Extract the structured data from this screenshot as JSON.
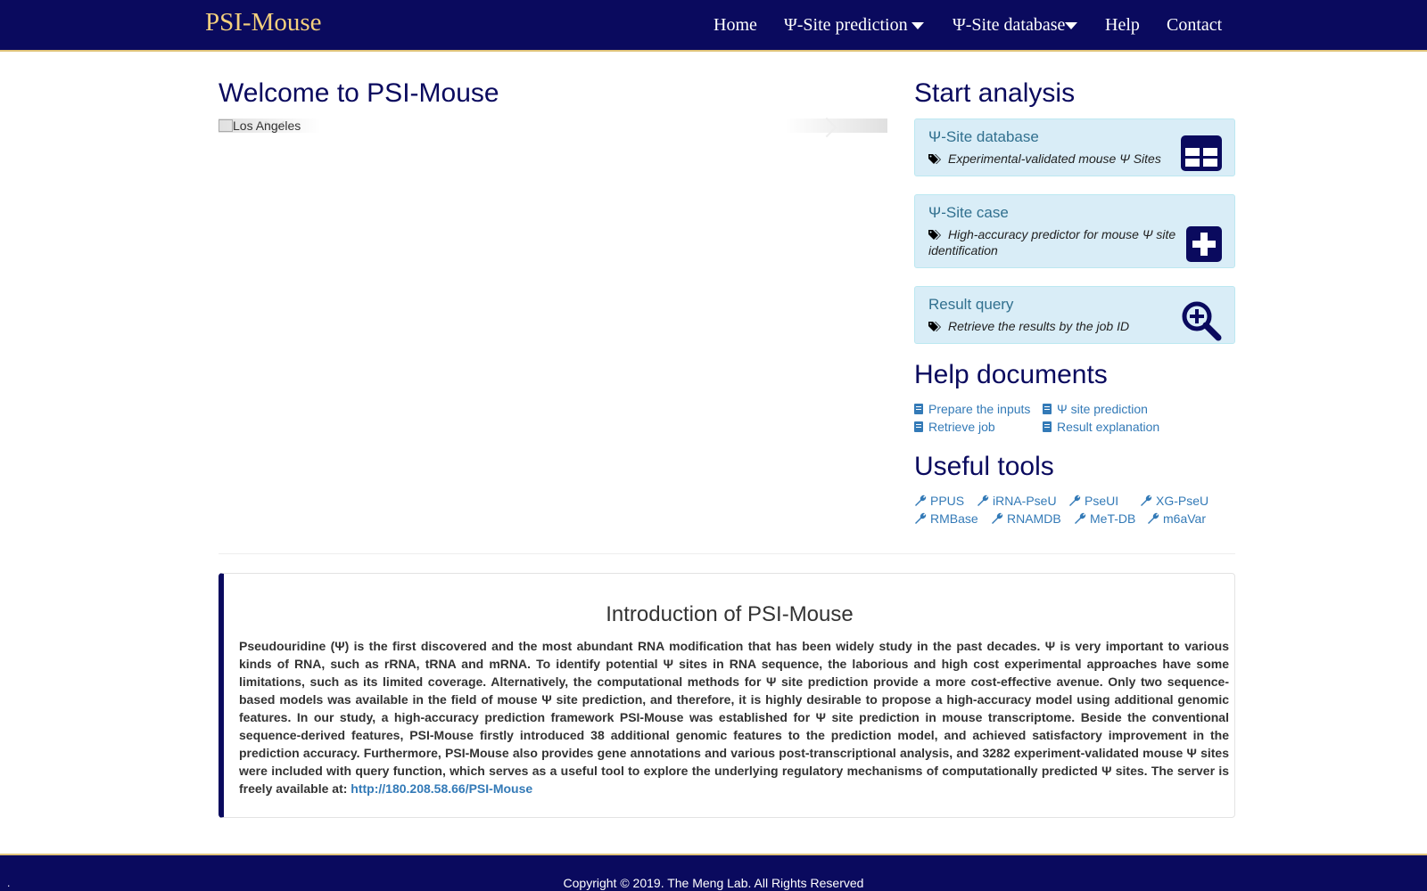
{
  "navbar": {
    "brand": "PSI-Mouse",
    "items": [
      {
        "label": "Home"
      },
      {
        "label": "Ψ-Site prediction"
      },
      {
        "label": "Ψ-Site database"
      },
      {
        "label": "Help"
      },
      {
        "label": "Contact"
      }
    ]
  },
  "welcome": {
    "title": "Welcome to PSI-Mouse",
    "carousel_alt": "Los Angeles"
  },
  "analysis": {
    "title": "Start analysis",
    "panels": [
      {
        "title": "Ψ-Site database",
        "desc": "Experimental-validated mouse Ψ Sites",
        "icon": "table-icon"
      },
      {
        "title": "Ψ-Site case",
        "desc": "High-accuracy predictor for mouse Ψ site identification",
        "icon": "plus-square-icon"
      },
      {
        "title": "Result query",
        "desc": "Retrieve the results by the job ID",
        "icon": "search-plus-icon"
      }
    ]
  },
  "help": {
    "title": "Help documents",
    "links": [
      "Prepare the inputs",
      "Ψ site prediction",
      "Retrieve job",
      "Result explanation"
    ]
  },
  "tools": {
    "title": "Useful tools",
    "links": [
      "PPUS",
      "iRNA-PseU",
      "PseUI",
      "XG-PseU",
      "RMBase",
      "RNAMDB",
      "MeT-DB",
      "m6aVar"
    ]
  },
  "intro": {
    "title": "Introduction of PSI-Mouse",
    "text": "Pseudouridine (Ψ) is the first discovered and the most abundant RNA modification that has been widely study in the past decades. Ψ is very important to various kinds of RNA, such as rRNA, tRNA and mRNA. To identify potential Ψ sites in RNA sequence, the laborious and high cost experimental approaches have some limitations, such as its limited coverage. Alternatively, the computational methods for Ψ site prediction provide a more cost-effective avenue. Only two sequence-based models was available in the field of mouse Ψ site prediction, and therefore, it is highly desirable to propose a high-accuracy model using additional genomic features. In our study, a high-accuracy prediction framework PSI-Mouse was established for Ψ site prediction in mouse transcriptome. Beside the conventional sequence-derived features, PSI-Mouse firstly introduced 38 additional genomic features to the prediction model, and achieved satisfactory improvement in the prediction accuracy. Furthermore, PSI-Mouse also provides gene annotations and various post-transcriptional analysis, and 3282 experiment-validated mouse Ψ sites were included with query function, which serves as a useful tool to explore the underlying regulatory mechanisms of computationally predicted Ψ sites. The server is freely available at: ",
    "link": "http://180.208.58.66/PSI-Mouse"
  },
  "footer": {
    "copyright": "Copyright © 2019. The Meng Lab. All Rights Reserved",
    "dot": "."
  },
  "colors": {
    "navy": "#0a0a5e",
    "gold": "#f3cf7d",
    "link": "#337ab7",
    "panel_bg": "#d9edf7",
    "panel_title": "#31708f"
  }
}
